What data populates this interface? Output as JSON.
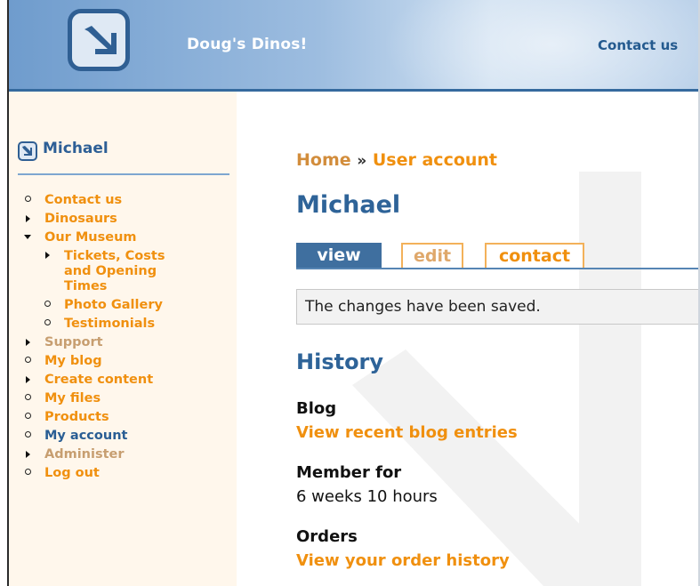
{
  "header": {
    "site_name": "Doug's Dinos!",
    "contact_link": "Contact us"
  },
  "sidebar": {
    "user_name": "Michael",
    "menu": [
      {
        "label": "Contact us",
        "marker": "bullet",
        "color": "#f0900f"
      },
      {
        "label": "Dinosaurs",
        "marker": "collapsed",
        "color": "#f0900f"
      },
      {
        "label": "Our Museum",
        "marker": "expanded",
        "color": "#f0900f",
        "children": [
          {
            "label": "Tickets, Costs and Opening Times",
            "marker": "collapsed"
          },
          {
            "label": "Photo Gallery",
            "marker": "bullet"
          },
          {
            "label": "Testimonials",
            "marker": "bullet"
          }
        ]
      },
      {
        "label": "Support",
        "marker": "collapsed",
        "color": "#c79e70"
      },
      {
        "label": "My blog",
        "marker": "bullet",
        "color": "#f0900f"
      },
      {
        "label": "Create content",
        "marker": "collapsed",
        "color": "#f0900f"
      },
      {
        "label": "My files",
        "marker": "bullet",
        "color": "#f0900f"
      },
      {
        "label": "Products",
        "marker": "bullet",
        "color": "#f0900f"
      },
      {
        "label": "My account",
        "marker": "bullet",
        "color": "#2a5e94"
      },
      {
        "label": "Administer",
        "marker": "collapsed",
        "color": "#c79e70"
      },
      {
        "label": "Log out",
        "marker": "bullet",
        "color": "#f0900f"
      }
    ]
  },
  "main": {
    "breadcrumb": {
      "home": "Home",
      "separator": "»",
      "current": "User account"
    },
    "title": "Michael",
    "tabs": [
      {
        "label": "view",
        "active": true
      },
      {
        "label": "edit",
        "active": false
      },
      {
        "label": "contact",
        "active": false
      }
    ],
    "status_message": "The changes have been saved.",
    "history_heading": "History",
    "sections": {
      "blog": {
        "label": "Blog",
        "link": "View recent blog entries"
      },
      "member": {
        "label": "Member for",
        "value": "6 weeks 10 hours"
      },
      "orders": {
        "label": "Orders",
        "link": "View your order history"
      }
    }
  },
  "colors": {
    "accent_orange": "#f0900f",
    "brand_blue": "#2e6398",
    "sidebar_bg": "#fff7ec"
  }
}
